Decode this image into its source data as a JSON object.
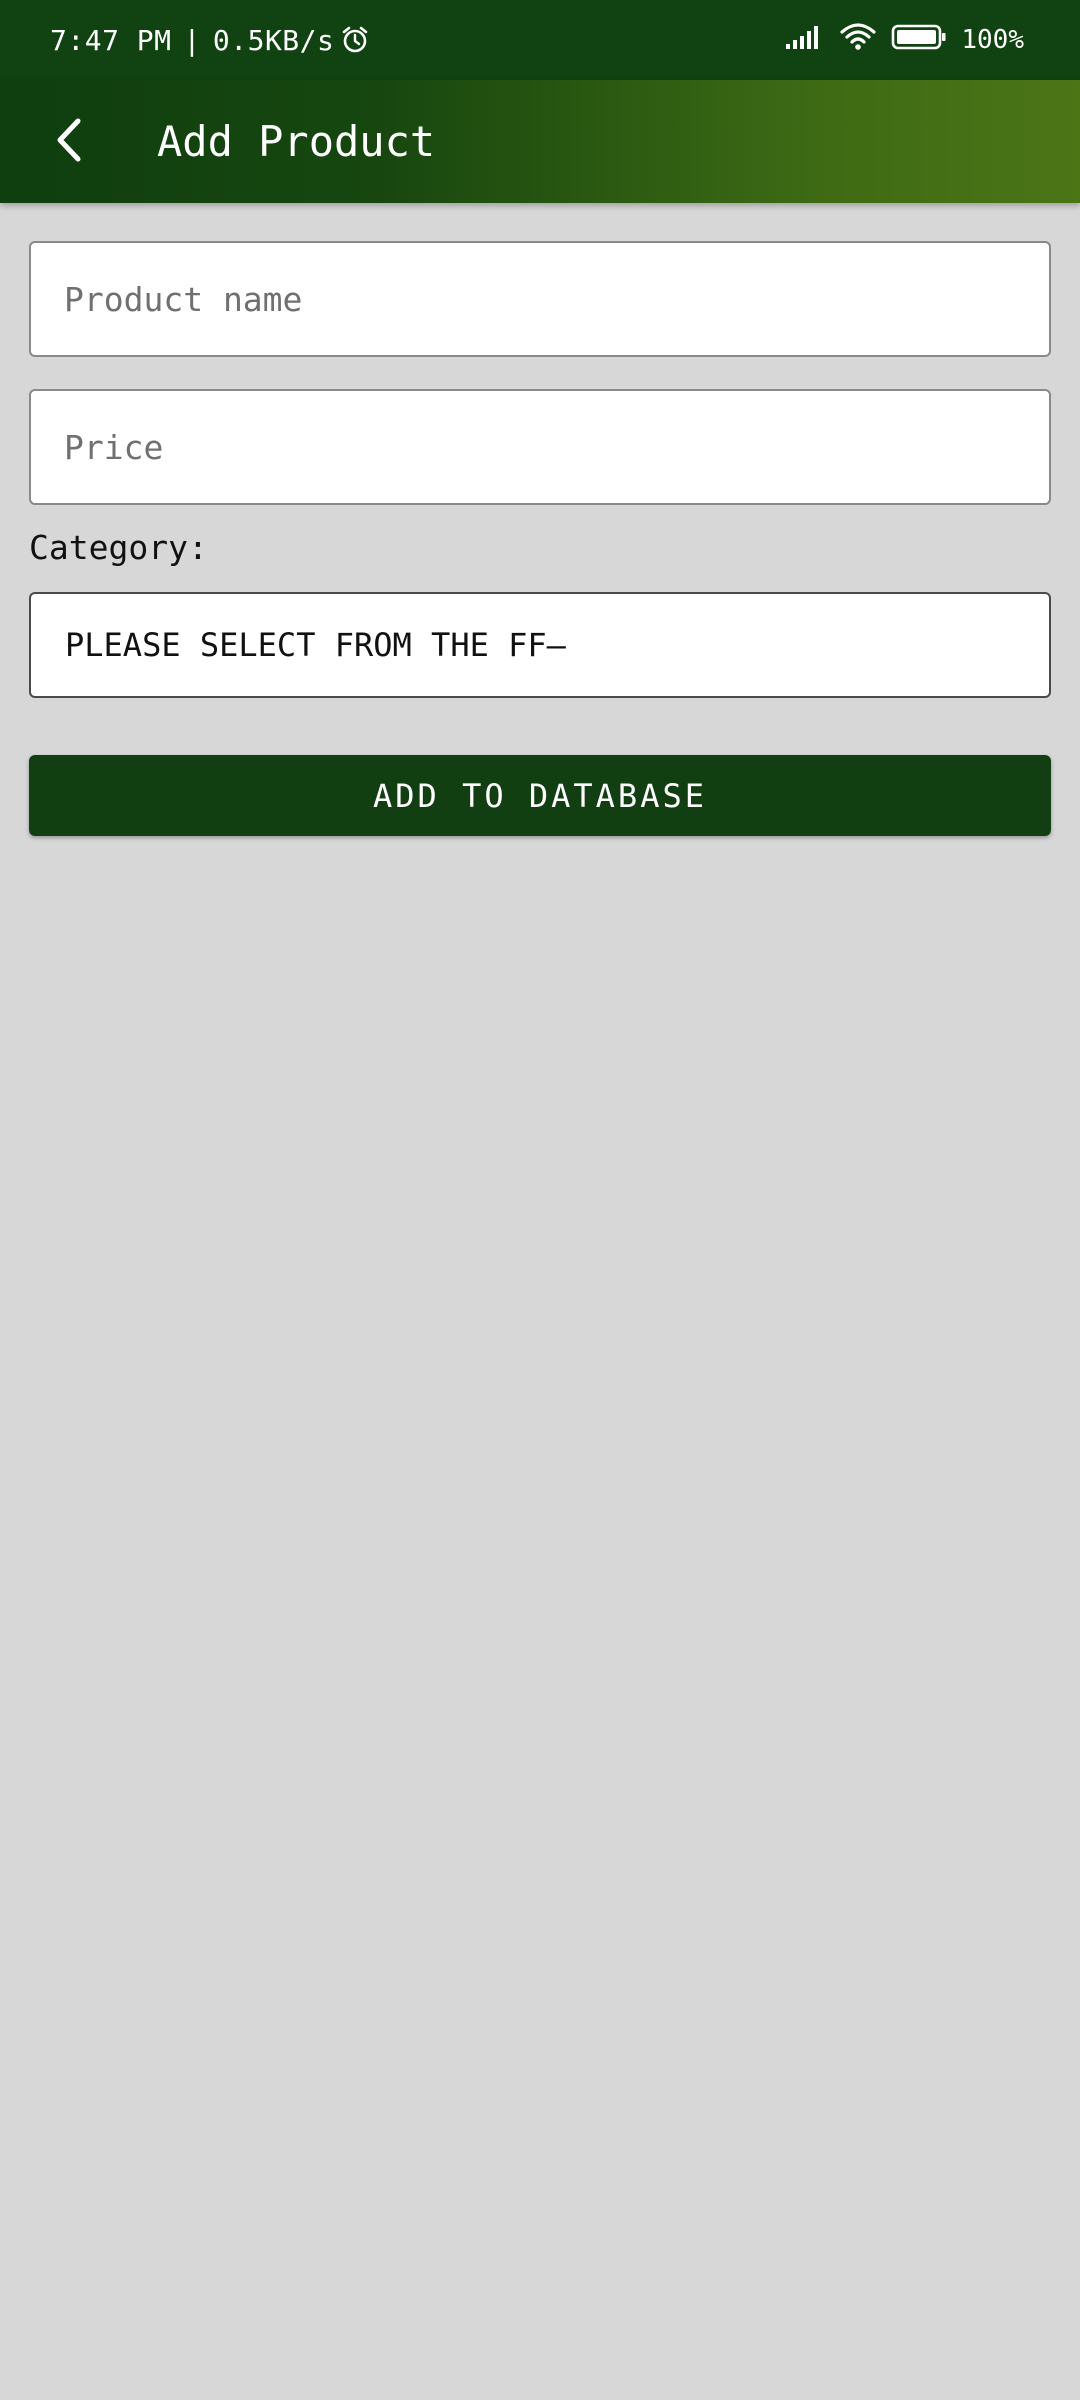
{
  "status_bar": {
    "time": "7:47 PM",
    "separator": "|",
    "network_speed": "0.5KB/s",
    "alarm_icon": "alarm-icon",
    "signal_icon": "signal-icon",
    "wifi_icon": "wifi-icon",
    "battery_icon": "battery-icon",
    "battery_percent": "100%"
  },
  "app_bar": {
    "back_icon": "back-arrow-icon",
    "title": "Add Product"
  },
  "form": {
    "product_name_placeholder": "Product name",
    "product_name_value": "",
    "price_placeholder": "Price",
    "price_value": "",
    "category_label": "Category:",
    "category_selected": "PLEASE SELECT FROM THE FF—",
    "submit_label": "ADD TO DATABASE"
  },
  "colors": {
    "status_bar_bg": "#114211",
    "app_bar_start": "#0f3e0f",
    "app_bar_end": "#4c7516",
    "button_bg": "#123f12",
    "page_bg": "#d7d7d7"
  }
}
